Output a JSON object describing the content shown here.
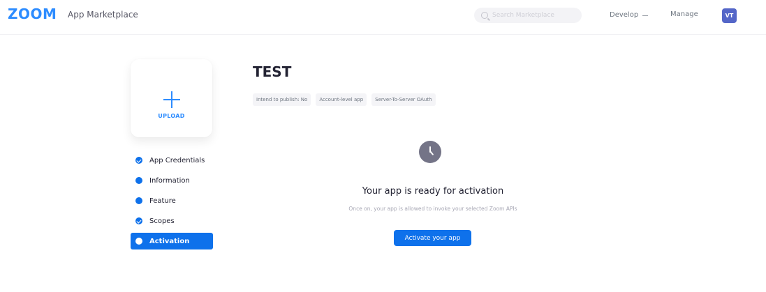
{
  "header": {
    "logo": "ZOOM",
    "title": "App Marketplace",
    "search": {
      "placeholder": "Search Marketplace"
    },
    "nav": {
      "develop": "Develop",
      "manage": "Manage"
    },
    "avatar_initials": "VT"
  },
  "upload": {
    "label": "UPLOAD"
  },
  "sidebar": {
    "items": [
      {
        "label": "App Credentials",
        "icon": "check-circle-icon",
        "active": false
      },
      {
        "label": "Information",
        "icon": "dot-icon",
        "active": false
      },
      {
        "label": "Feature",
        "icon": "dot-icon",
        "active": false
      },
      {
        "label": "Scopes",
        "icon": "check-circle-icon",
        "active": false
      },
      {
        "label": "Activation",
        "icon": "dot-icon",
        "active": true
      }
    ]
  },
  "main": {
    "app_name": "TEST",
    "tags": [
      "Intend to publish: No",
      "Account-level app",
      "Server-To-Server OAuth"
    ],
    "status_icon": "clock-icon",
    "ready_title": "Your app is ready for activation",
    "ready_description": "Once on, your app is allowed to invoke your selected Zoom APIs",
    "activate_label": "Activate your app"
  },
  "colors": {
    "brand": "#2d8cff",
    "accent": "#0e71eb",
    "clock": "#747487"
  }
}
